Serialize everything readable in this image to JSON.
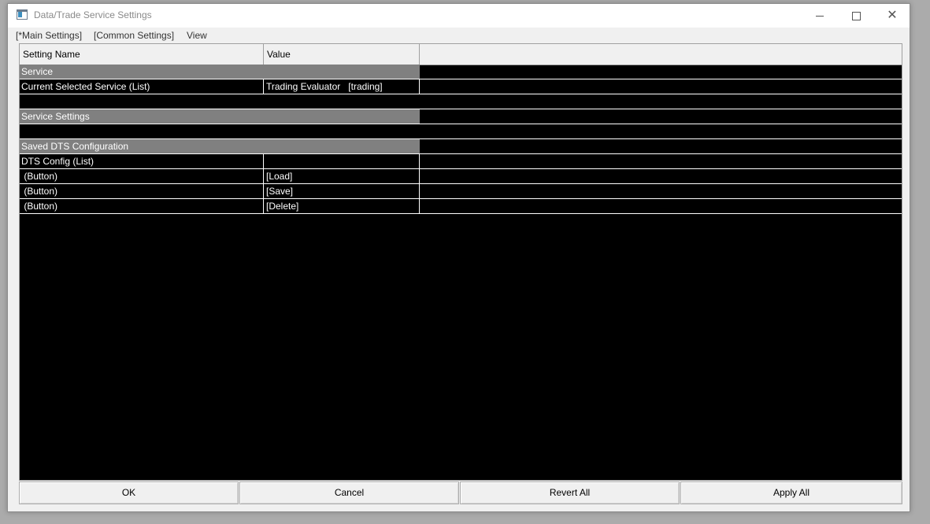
{
  "window": {
    "title": "Data/Trade Service Settings"
  },
  "menu": {
    "items": [
      "[*Main Settings]",
      "[Common Settings]",
      "View"
    ]
  },
  "grid": {
    "columns": [
      "Setting Name",
      "Value",
      ""
    ],
    "rows": [
      {
        "kind": "section",
        "name": "Service",
        "value": ""
      },
      {
        "kind": "item",
        "name": "Current Selected Service (List)",
        "value": "Trading Evaluator   [trading]"
      },
      {
        "kind": "blank",
        "name": "",
        "value": ""
      },
      {
        "kind": "section",
        "name": "Service Settings",
        "value": ""
      },
      {
        "kind": "blank",
        "name": "",
        "value": ""
      },
      {
        "kind": "section",
        "name": "Saved DTS Configuration",
        "value": ""
      },
      {
        "kind": "item",
        "name": "DTS Config (List)",
        "value": ""
      },
      {
        "kind": "item",
        "name": " (Button)",
        "value": "[Load]"
      },
      {
        "kind": "item",
        "name": " (Button)",
        "value": "[Save]"
      },
      {
        "kind": "item",
        "name": " (Button)",
        "value": "[Delete]"
      }
    ]
  },
  "footer": {
    "ok_label": "OK",
    "cancel_label": "Cancel",
    "revert_label": "Revert All",
    "apply_label": "Apply All"
  },
  "colors": {
    "grid_background": "#000000",
    "section_header": "#808080",
    "text_on_grid": "#ffffff"
  }
}
